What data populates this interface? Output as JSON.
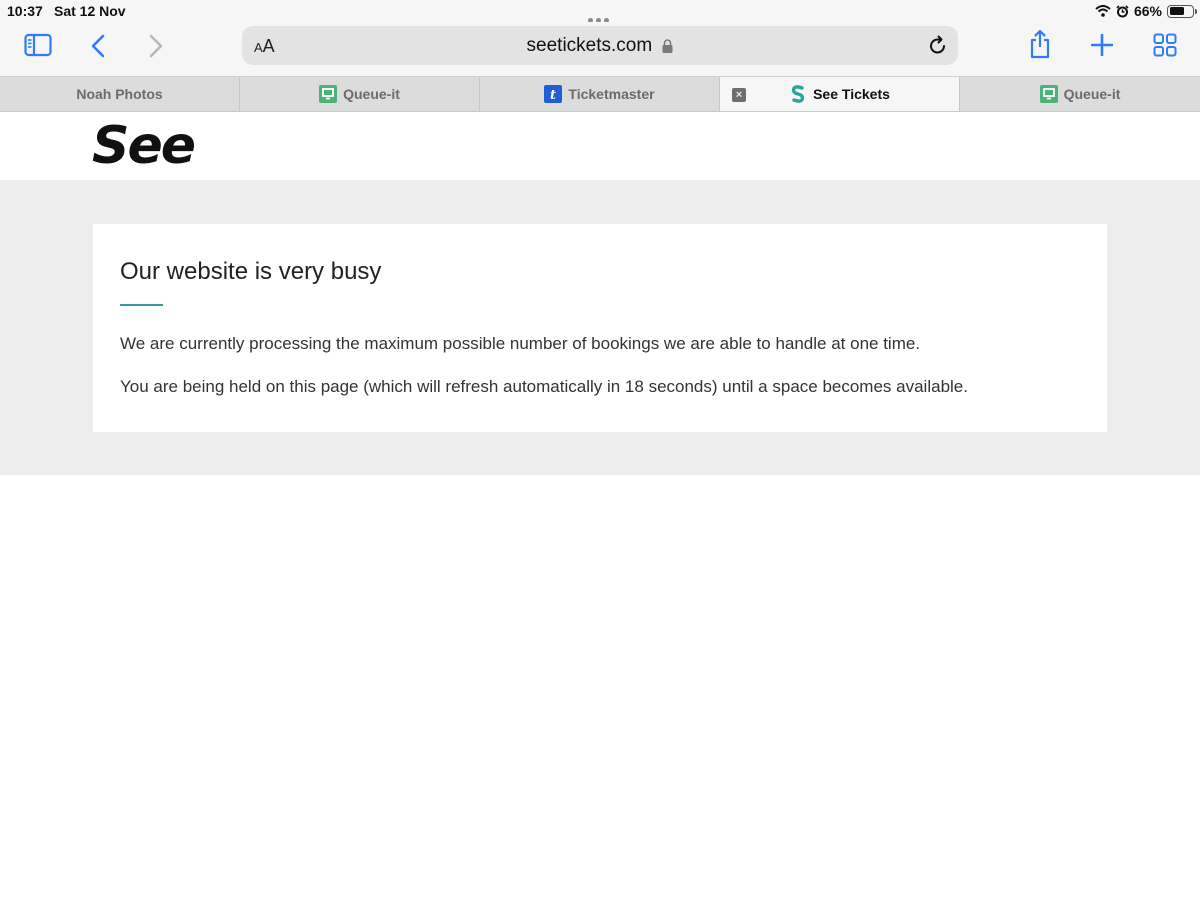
{
  "status_bar": {
    "time": "10:37",
    "date": "Sat 12 Nov",
    "battery_percent": "66%",
    "battery_level": 0.66
  },
  "toolbar": {
    "text_size_small": "A",
    "text_size_large": "A",
    "url": "seetickets.com",
    "icons": [
      "sidebar-icon",
      "back-icon",
      "forward-icon",
      "lock-icon",
      "reload-icon",
      "share-icon",
      "new-tab-icon",
      "tab-overview-icon"
    ],
    "accent_color": "#2f7cf6"
  },
  "tabs": [
    {
      "label": "Noah Photos",
      "favicon": "none",
      "active": false
    },
    {
      "label": "Queue-it",
      "favicon": "queue-it-icon",
      "active": false
    },
    {
      "label": "Ticketmaster",
      "favicon": "ticketmaster-icon",
      "active": false
    },
    {
      "label": "See Tickets",
      "favicon": "see-tickets-icon",
      "active": true
    },
    {
      "label": "Queue-it",
      "favicon": "queue-it-icon",
      "active": false
    }
  ],
  "page": {
    "logo_text": "See",
    "heading": "Our website is very busy",
    "paragraph_1": "We are currently processing the maximum possible number of bookings we are able to handle at one time.",
    "paragraph_2": "You are being held on this page (which will refresh automatically in 18 seconds) until a space becomes available.",
    "accent_rule_color": "#3a9a9a"
  }
}
